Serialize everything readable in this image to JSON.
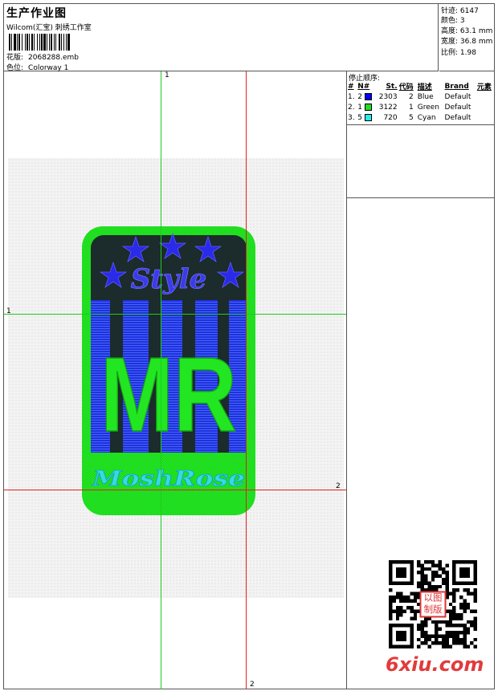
{
  "header": {
    "title": "生产作业图",
    "software": "Wilcom(汇宝) 刺绣工作室",
    "design_label": "花版:",
    "design_value": "2068288.emb",
    "colorway_label": "色位:",
    "colorway_value": "Colorway 1"
  },
  "stats": [
    {
      "label": "针迹:",
      "value": "6147"
    },
    {
      "label": "颜色:",
      "value": "3"
    },
    {
      "label": "高度:",
      "value": "63.1 mm"
    },
    {
      "label": "宽度:",
      "value": "36.8 mm"
    },
    {
      "label": "比例:",
      "value": "1.98"
    }
  ],
  "stop_sequence": {
    "title": "停止顺序:",
    "headers": [
      "#",
      "N#",
      "St.",
      "代码",
      "描述",
      "Brand",
      "元素"
    ],
    "rows": [
      {
        "idx": "1.",
        "n": "2",
        "color": "#0000ff",
        "st": "2303",
        "code": "2",
        "desc": "Blue",
        "brand": "Default"
      },
      {
        "idx": "2.",
        "n": "1",
        "color": "#22dd22",
        "st": "3122",
        "code": "1",
        "desc": "Green",
        "brand": "Default"
      },
      {
        "idx": "3.",
        "n": "5",
        "color": "#22eeee",
        "st": "720",
        "code": "5",
        "desc": "Cyan",
        "brand": "Default"
      }
    ]
  },
  "canvas": {
    "axis_labels": {
      "top_green": "1",
      "left_green": "1",
      "right_red": "2",
      "bottom_red": "2"
    },
    "design_text": {
      "style": "Style",
      "initials": "MR",
      "script": "MoshRose"
    },
    "thread_colors": {
      "outline": "#22e622",
      "fill_dark": "#1c2b2b",
      "stripe": "#2030e0",
      "star": "#2a2ae8",
      "script": "#33dddd"
    }
  },
  "qr": {
    "seal_text": "以图制版"
  },
  "watermark": "6xiu.com"
}
